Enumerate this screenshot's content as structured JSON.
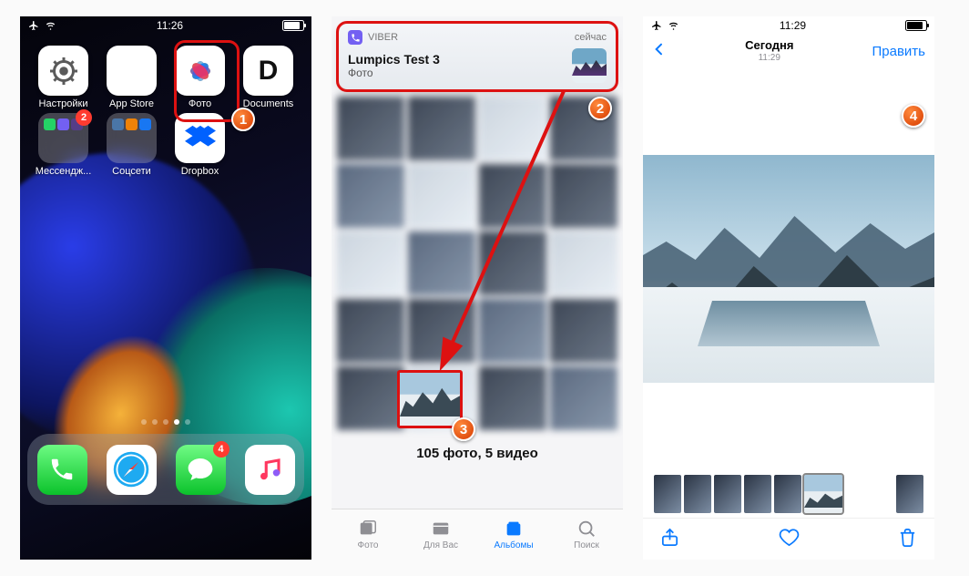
{
  "phone1": {
    "status": {
      "time": "11:26"
    },
    "apps": [
      {
        "label": "Настройки"
      },
      {
        "label": "App Store"
      },
      {
        "label": "Фото"
      },
      {
        "label": "Documents"
      },
      {
        "label": "Мессендж..."
      },
      {
        "label": "Соцсети"
      },
      {
        "label": "Dropbox"
      }
    ],
    "badges": {
      "messengers": "2",
      "messages_dock": "4"
    }
  },
  "phone2": {
    "notification": {
      "app": "VIBER",
      "time": "сейчас",
      "title": "Lumpics Test 3",
      "subtitle": "Фото"
    },
    "caption": "105 фото, 5 видео",
    "tabs": {
      "photos": "Фото",
      "foryou": "Для Вас",
      "albums": "Альбомы",
      "search": "Поиск"
    }
  },
  "phone3": {
    "status": {
      "time": "11:29"
    },
    "nav": {
      "title": "Сегодня",
      "subtitle": "11:29",
      "edit": "Править"
    }
  },
  "steps": {
    "s1": "1",
    "s2": "2",
    "s3": "3",
    "s4": "4"
  }
}
